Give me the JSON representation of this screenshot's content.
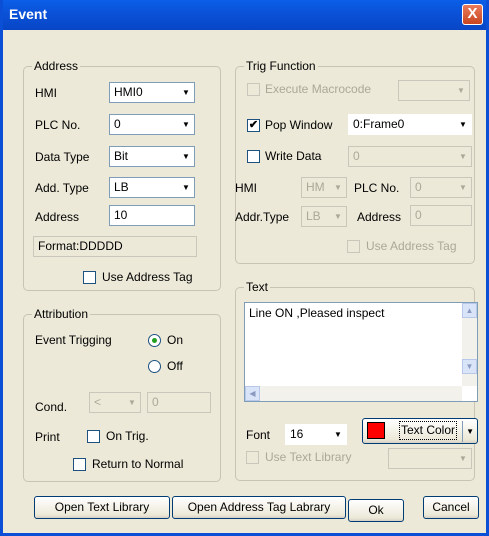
{
  "window": {
    "title": "Event",
    "close_glyph": "X"
  },
  "address": {
    "legend": "Address",
    "hmi_label": "HMI",
    "hmi_value": "HMI0",
    "plc_label": "PLC No.",
    "plc_value": "0",
    "datatype_label": "Data Type",
    "datatype_value": "Bit",
    "addtype_label": "Add. Type",
    "addtype_value": "LB",
    "address_label": "Address",
    "address_value": "10",
    "format_text": "Format:DDDDD",
    "use_tag_label": "Use Address Tag",
    "use_tag_checked": false
  },
  "trig": {
    "legend": "Trig Function",
    "exec_macro_label": "Execute Macrocode",
    "exec_macro_checked": false,
    "pop_window_label": "Pop Window",
    "pop_window_checked": true,
    "pop_window_value": "0:Frame0",
    "write_data_label": "Write Data",
    "write_data_checked": false,
    "write_data_value": "0",
    "hmi_label": "HMI",
    "hmi_value": "HM",
    "plc_label": "PLC No.",
    "plc_value": "0",
    "addr_type_label": "Addr.Type",
    "addr_type_value": "LB",
    "address_label": "Address",
    "address_value": "0",
    "use_tag_label": "Use Address Tag",
    "use_tag_checked": false
  },
  "attribution": {
    "legend": "Attribution",
    "event_trigging_label": "Event Trigging",
    "on_label": "On",
    "off_label": "Off",
    "selected": "On",
    "cond_label": "Cond.",
    "cond_value": "<",
    "cond_number": "0",
    "print_label": "Print",
    "on_trig_label": "On Trig.",
    "on_trig_checked": false,
    "return_normal_label": "Return to Normal",
    "return_normal_checked": false
  },
  "text": {
    "legend": "Text",
    "content": "Line ON ,Pleased inspect",
    "font_label": "Font",
    "font_value": "16",
    "color_button_label": "Text Color",
    "color_value": "#ff0000",
    "use_library_label": "Use Text Library",
    "use_library_checked": false
  },
  "buttons": {
    "open_text_library": "Open Text Library",
    "open_tag_library": "Open Address Tag Labrary",
    "ok": "Ok",
    "cancel": "Cancel"
  },
  "icons": {
    "checkmark": "✔",
    "dropdown": "▼",
    "scroll_up": "▲",
    "scroll_down": "▼",
    "scroll_left": "◀"
  }
}
